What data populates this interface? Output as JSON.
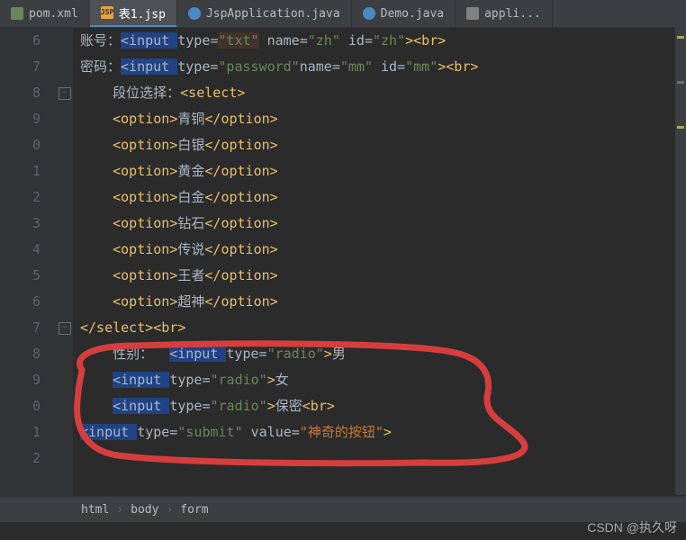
{
  "tabs": [
    {
      "icon": "xml",
      "label": "pom.xml"
    },
    {
      "icon": "jsp",
      "label": "表1.jsp",
      "active": true
    },
    {
      "icon": "java",
      "label": "JspApplication.java"
    },
    {
      "icon": "java",
      "label": "Demo.java"
    },
    {
      "icon": "prop",
      "label": "appli..."
    }
  ],
  "lineNumbers": [
    "6",
    "7",
    "8",
    "9",
    "0",
    "1",
    "2",
    "3",
    "4",
    "5",
    "6",
    "7",
    "8",
    "9",
    "0",
    "1",
    "2"
  ],
  "code": {
    "l0": {
      "t1": "账号：",
      "tag1": "<input ",
      "a1": "type=",
      "v1": "\"txt\"",
      "a2": " name=",
      "v2": "\"zh\"",
      "a3": " id=",
      "v3": "\"zh\"",
      "tag2": "><br>"
    },
    "l1": {
      "t1": "密码：",
      "tag1": "<input ",
      "a1": "type=",
      "v1": "\"password\"",
      "a2": "name=",
      "v2": "\"mm\"",
      "a3": " id=",
      "v3": "\"mm\"",
      "tag2": "><br>"
    },
    "l2": {
      "indent": "    ",
      "t1": "段位选择：",
      "tag1": "<select>"
    },
    "l3": {
      "indent": "    ",
      "tag1": "<option>",
      "t1": "青铜",
      "tag2": "</option>"
    },
    "l4": {
      "indent": "    ",
      "tag1": "<option>",
      "t1": "白银",
      "tag2": "</option>"
    },
    "l5": {
      "indent": "    ",
      "tag1": "<option>",
      "t1": "黄金",
      "tag2": "</option>"
    },
    "l6": {
      "indent": "    ",
      "tag1": "<option>",
      "t1": "白金",
      "tag2": "</option>"
    },
    "l7": {
      "indent": "    ",
      "tag1": "<option>",
      "t1": "钻石",
      "tag2": "</option>"
    },
    "l8": {
      "indent": "    ",
      "tag1": "<option>",
      "t1": "传说",
      "tag2": "</option>"
    },
    "l9": {
      "indent": "    ",
      "tag1": "<option>",
      "t1": "王者",
      "tag2": "</option>"
    },
    "l10": {
      "indent": "    ",
      "tag1": "<option>",
      "t1": "超神",
      "tag2": "</option>"
    },
    "l11": {
      "tag1": "</select><br>"
    },
    "l12": {
      "indent": "    ",
      "t1": "性别：  ",
      "tag1": "<input ",
      "a1": "type=",
      "v1": "\"radio\"",
      "tag2": ">",
      "t2": "男"
    },
    "l13": {
      "indent": "    ",
      "tag1": "<input ",
      "a1": "type=",
      "v1": "\"radio\"",
      "tag2": ">",
      "t2": "女"
    },
    "l14": {
      "indent": "    ",
      "tag1": "<input ",
      "a1": "type=",
      "v1": "\"radio\"",
      "tag2": ">",
      "t2": "保密",
      "tag3": "<br>"
    },
    "l15": {
      "tag1": "<input ",
      "a1": "type=",
      "v1": "\"submit\"",
      "a2": " value=",
      "v2": "\"神奇的按钮\"",
      "tag2": ">"
    }
  },
  "breadcrumb": {
    "c1": "html",
    "c2": "body",
    "c3": "form"
  },
  "watermark": "CSDN @执久呀"
}
